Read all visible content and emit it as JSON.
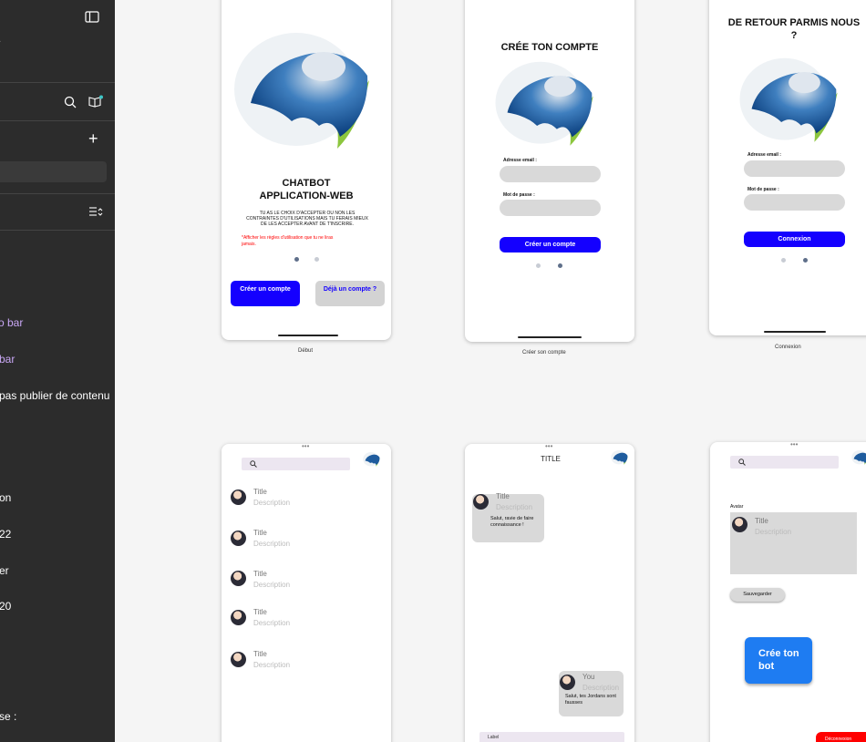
{
  "sidebar": {
    "purple_1": "o bar",
    "purple_2": "bar",
    "line_3": "pas publier de contenu",
    "line_4": "on",
    "line_5": "22",
    "line_6": "er",
    "line_7": "20",
    "line_8": "se :"
  },
  "frames": {
    "debut": {
      "caption": "Début",
      "title1": "CHATBOT",
      "title2": "APPLICATION-WEB",
      "paragraph": "TU AS LE CHOIX D'ACCEPTER OU NON LES CONTRAINTES D'UTILISATIONS MAIS TU FERAIS MIEUX DE LES ACCEPTER AVANT DE T'INSCRIRE.",
      "rules_link": "*Afficher les règles d'utilisation que tu ne liras jamais.",
      "create_button": "Créer un compte",
      "already_button": "Déjà un compte ?"
    },
    "creer": {
      "caption": "Créer son compte",
      "title": "CRÉE TON COMPTE",
      "email_label": "Adresse email :",
      "password_label": "Mot de passe :",
      "submit_button": "Créer un  compte"
    },
    "connexion": {
      "caption": "Connexion",
      "title": "DE RETOUR PARMIS NOUS ?",
      "email_label": "Adresse email :",
      "password_label": "Mot de passe :",
      "submit_button": "Connexion"
    },
    "list": {
      "items": [
        {
          "title": "Title",
          "desc": "Description"
        },
        {
          "title": "Title",
          "desc": "Description"
        },
        {
          "title": "Title",
          "desc": "Description"
        },
        {
          "title": "Title",
          "desc": "Description"
        },
        {
          "title": "Title",
          "desc": "Description"
        }
      ]
    },
    "chat": {
      "header": "TITLE",
      "bot_title": "Title",
      "bot_desc": "Description",
      "bot_msg": "Salut, ravie de faire connaissance !",
      "user_title": "You",
      "user_desc": "Description",
      "user_msg": "Salut, tes Jordans sont fausses",
      "input_label": "Label"
    },
    "profile": {
      "avatar_label": "Avatar",
      "card_title": "Title",
      "card_desc": "Description",
      "save_button": "Sauvegarder",
      "create_bot_button": "Crée ton bot",
      "logout_button": "Déconnexion"
    }
  },
  "colors": {
    "primary_blue": "#1400ff",
    "sidebar_bg": "#2c2c2c",
    "accent_purple": "#c9a7f5",
    "create_bot_blue": "#1e7cf2",
    "logout_red": "#ff0000"
  }
}
